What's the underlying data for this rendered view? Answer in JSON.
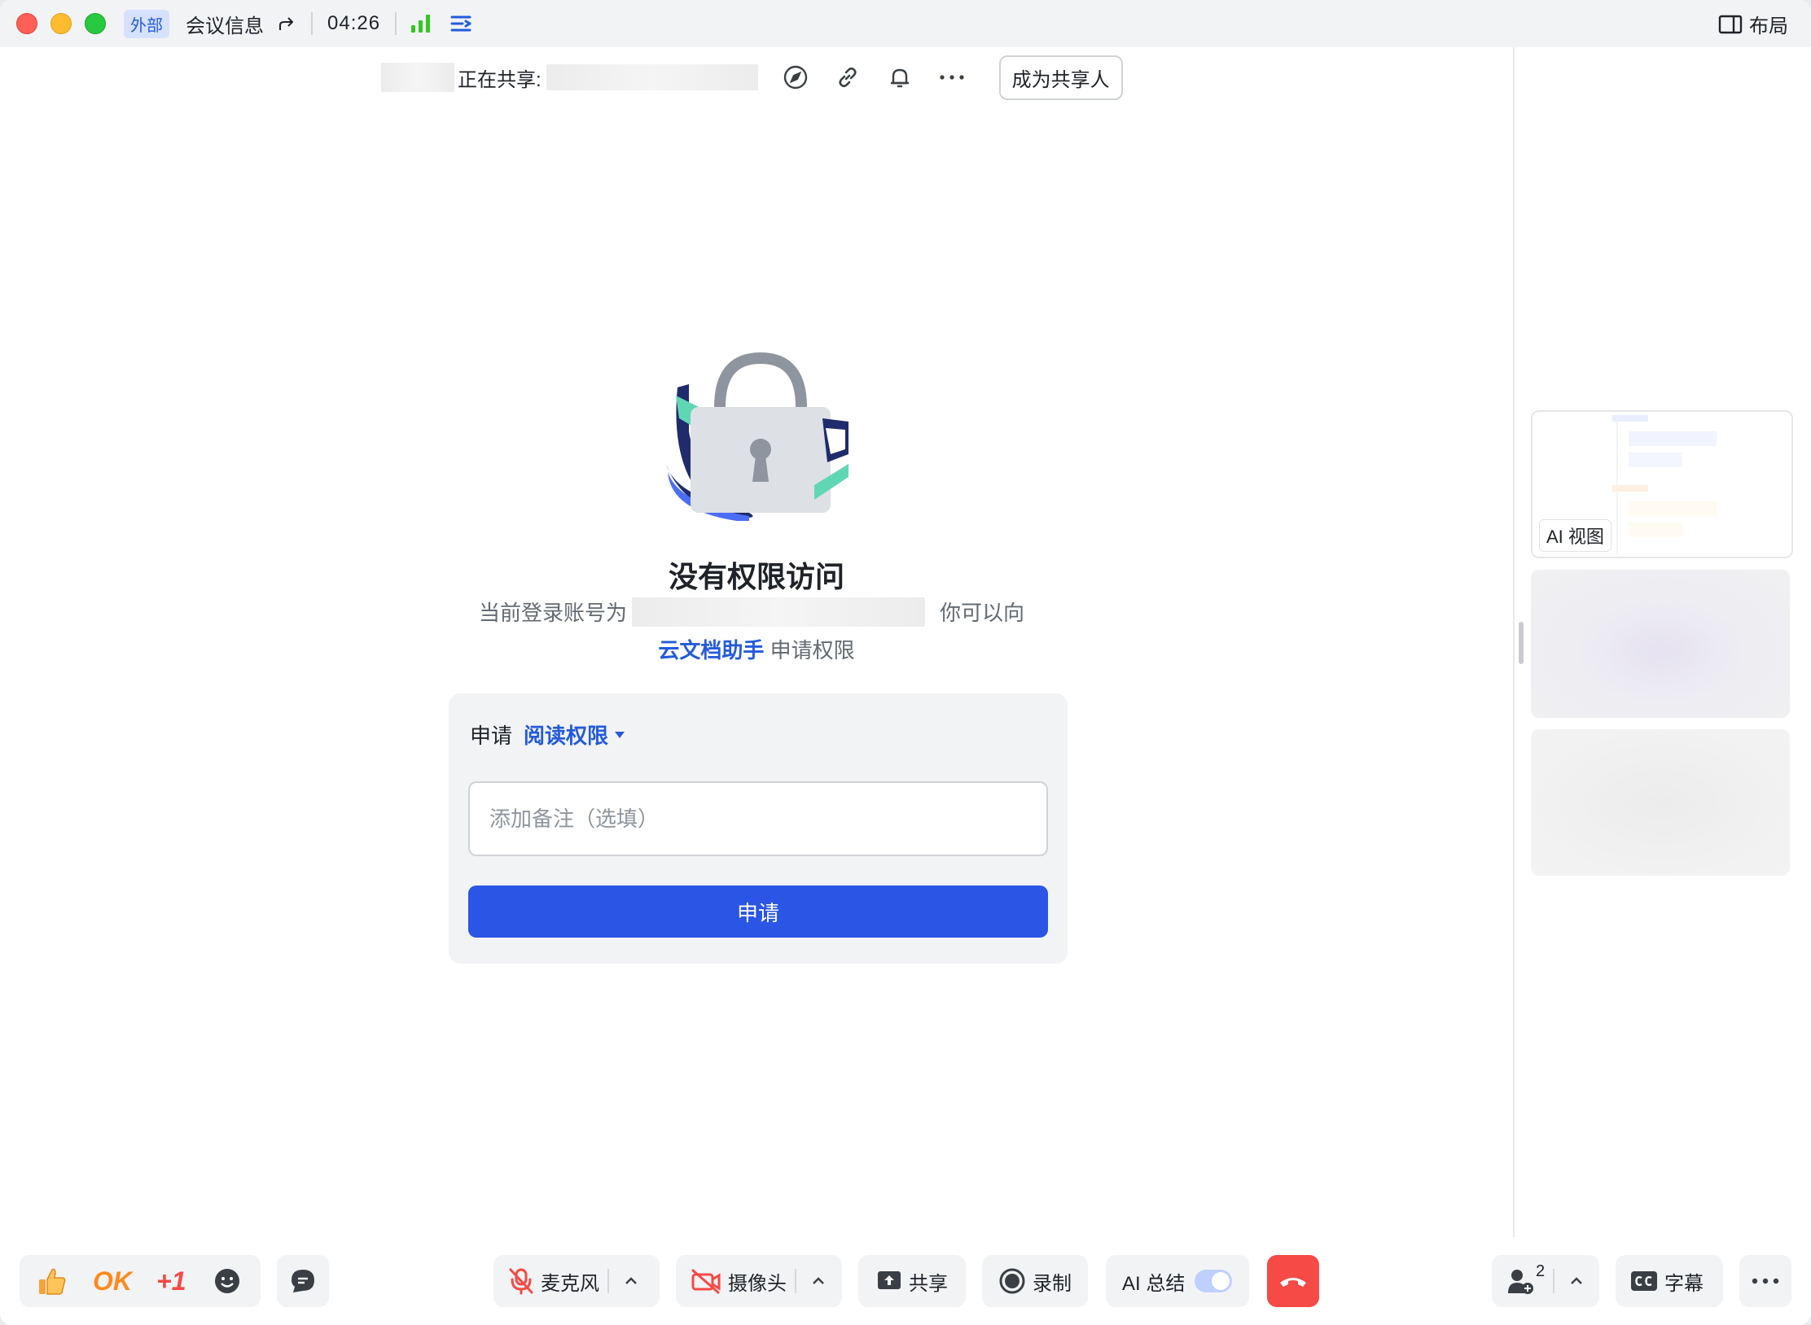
{
  "titlebar": {
    "badge": "外部",
    "meeting_info": "会议信息",
    "timer": "04:26",
    "layout_label": "布局"
  },
  "sharebar": {
    "sharing_label": "正在共享:",
    "become_sharer": "成为共享人"
  },
  "center": {
    "title": "没有权限访问",
    "line1_prefix": "当前登录账号为",
    "line1_suffix": "你可以向",
    "assistant_link": "云文档助手",
    "line2_suffix": "申请权限"
  },
  "form": {
    "apply_label": "申请",
    "permission": "阅读权限",
    "note_placeholder": "添加备注（选填）",
    "submit": "申请"
  },
  "right_panel": {
    "ai_view_label": "AI 视图"
  },
  "bottombar": {
    "reaction_ok": "OK",
    "reaction_plus1": "+1",
    "mic": "麦克风",
    "camera": "摄像头",
    "share": "共享",
    "record": "录制",
    "ai_summary": "AI 总结",
    "participants_count": "2",
    "captions": "字幕"
  },
  "colors": {
    "accent": "#245bdb",
    "primary_button": "#2a55e5",
    "end_call": "#f54a45",
    "signal": "#34c724"
  }
}
